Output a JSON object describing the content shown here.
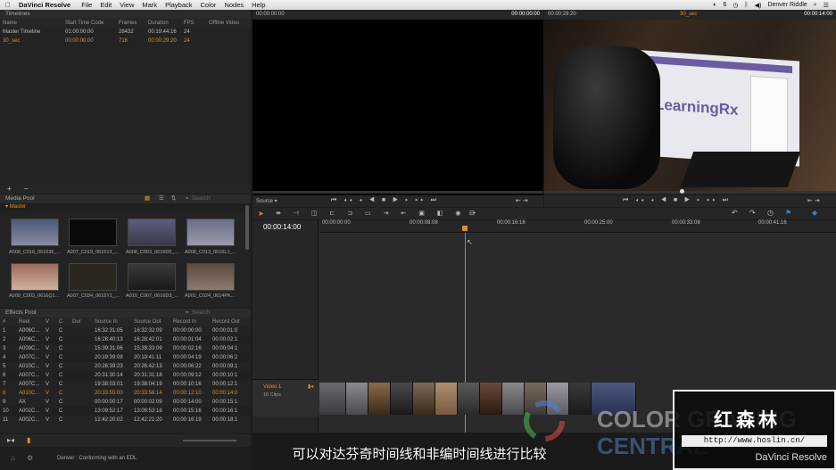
{
  "menubar": {
    "app": "DaVinci Resolve",
    "items": [
      "File",
      "Edit",
      "View",
      "Mark",
      "Playback",
      "Color",
      "Nodes",
      "Help"
    ],
    "battery_count": "6",
    "user": "Denver Riddle"
  },
  "timelines": {
    "title": "Timelines",
    "columns": [
      "Name",
      "Start Time Code",
      "Frames",
      "Duration",
      "FPS",
      "Offline Video"
    ],
    "rows": [
      {
        "name": "Master Timeline",
        "start": "01:00:00:00",
        "frames": "28432",
        "duration": "00:19:44:16",
        "fps": "24",
        "offline": ""
      },
      {
        "name": "30_sec",
        "start": "00:00:00:00",
        "frames": "716",
        "duration": "00:00:29:20",
        "fps": "24",
        "offline": ""
      }
    ],
    "add_label": "+",
    "remove_label": "−"
  },
  "media_pool": {
    "title": "Media Pool",
    "search_placeholder": "Search",
    "folder": "Master",
    "clips": [
      {
        "name": "A008_C016_061636_..."
      },
      {
        "name": "A007_C019_061513_..."
      },
      {
        "name": "A008_C003_0616D5_..."
      },
      {
        "name": "A008_C013_0616LJ_..."
      },
      {
        "name": "A009_C003_0616Q1..."
      },
      {
        "name": "A007_C034_0615Y1_..."
      },
      {
        "name": "A010_C007_0616D3_..."
      },
      {
        "name": "A001_C024_0614PK..."
      }
    ]
  },
  "effects_pool": {
    "title": "Effects Pool",
    "search_placeholder": "Search",
    "columns": [
      "#",
      "Reel",
      "V",
      "C",
      "Dur",
      "Source In",
      "Source Out",
      "Record In",
      "Record Out"
    ],
    "rows": [
      {
        "n": "1",
        "reel": "A006C...",
        "v": "V",
        "c": "C",
        "dur": "",
        "sin": "16:32:31:05",
        "sout": "16:32:32:09",
        "rin": "00:00:00:00",
        "rout": "00:00:01:0"
      },
      {
        "n": "2",
        "reel": "A006C...",
        "v": "V",
        "c": "C",
        "dur": "",
        "sin": "16:28:40:13",
        "sout": "16:28:42:01",
        "rin": "00:00:01:04",
        "rout": "00:00:02:1"
      },
      {
        "n": "3",
        "reel": "A009C...",
        "v": "V",
        "c": "C",
        "dur": "",
        "sin": "15:39:31:06",
        "sout": "15:39:33:09",
        "rin": "00:00:02:16",
        "rout": "00:00:04:1"
      },
      {
        "n": "4",
        "reel": "A007C...",
        "v": "V",
        "c": "C",
        "dur": "",
        "sin": "20:19:39:08",
        "sout": "20:19:41:11",
        "rin": "00:00:04:19",
        "rout": "00:00:06:2"
      },
      {
        "n": "5",
        "reel": "A010C...",
        "v": "V",
        "c": "C",
        "dur": "",
        "sin": "20:26:39:23",
        "sout": "20:26:42:13",
        "rin": "00:00:06:22",
        "rout": "00:00:09:1"
      },
      {
        "n": "6",
        "reel": "A007C...",
        "v": "V",
        "c": "C",
        "dur": "",
        "sin": "20:31:30:14",
        "sout": "20:31:31:18",
        "rin": "00:00:09:12",
        "rout": "00:00:10:1"
      },
      {
        "n": "7",
        "reel": "A007C...",
        "v": "V",
        "c": "C",
        "dur": "",
        "sin": "19:38:03:01",
        "sout": "19:38:04:19",
        "rin": "00:00:10:16",
        "rout": "00:00:12:1"
      },
      {
        "n": "8",
        "reel": "A010C...",
        "v": "V",
        "c": "C",
        "dur": "",
        "sin": "20:33:55:00",
        "sout": "20:33:56:14",
        "rin": "00:00:12:10",
        "rout": "00:00:14:0"
      },
      {
        "n": "9",
        "reel": "AX",
        "v": "V",
        "c": "C",
        "dur": "",
        "sin": "00:00:00:17",
        "sout": "00:00:02:09",
        "rin": "00:00:14:00",
        "rout": "00:00:15:1"
      },
      {
        "n": "10",
        "reel": "A002C...",
        "v": "V",
        "c": "C",
        "dur": "",
        "sin": "13:09:52:17",
        "sout": "13:09:53:18",
        "rin": "00:00:15:16",
        "rout": "00:00:16:1"
      },
      {
        "n": "11",
        "reel": "A002C...",
        "v": "V",
        "c": "C",
        "dur": "",
        "sin": "12:42:20:02",
        "sout": "12:42:21:20",
        "rin": "00:00:16:19",
        "rout": "00:00:18:1"
      }
    ],
    "selected_row": 7
  },
  "source_viewer": {
    "tc_left": "00:00:00:00",
    "tc_right": "00:00:00:00",
    "mode": "Source"
  },
  "record_viewer": {
    "tc_left": "00:00:29:20",
    "name": "30_sec",
    "tc_right": "00:00:14:00",
    "logo_text": "LearningRx"
  },
  "timeline": {
    "current_tc": "00:00:14:00",
    "ruler": [
      "00:00:00:00",
      "00:00:08:08",
      "00:00:16:16",
      "00:00:25:00",
      "00:00:33:08",
      "00:00:41:16"
    ],
    "track_name": "Video 1",
    "track_clips": "16 Clips"
  },
  "status": {
    "text": "Denver : Conforming with an EDL"
  },
  "subtitle": "可以对达芬奇时间线和非编时间线进行比较",
  "watermark": {
    "line1": "COLOR GRADING",
    "line2": "CENTRAL",
    "chinese": "红森林",
    "url": "http://www.hoslin.cn/",
    "product": "DaVinci Resolve"
  },
  "colors": {
    "accent": "#e08c2c",
    "panel": "#232323",
    "bg": "#1c1c1c"
  }
}
